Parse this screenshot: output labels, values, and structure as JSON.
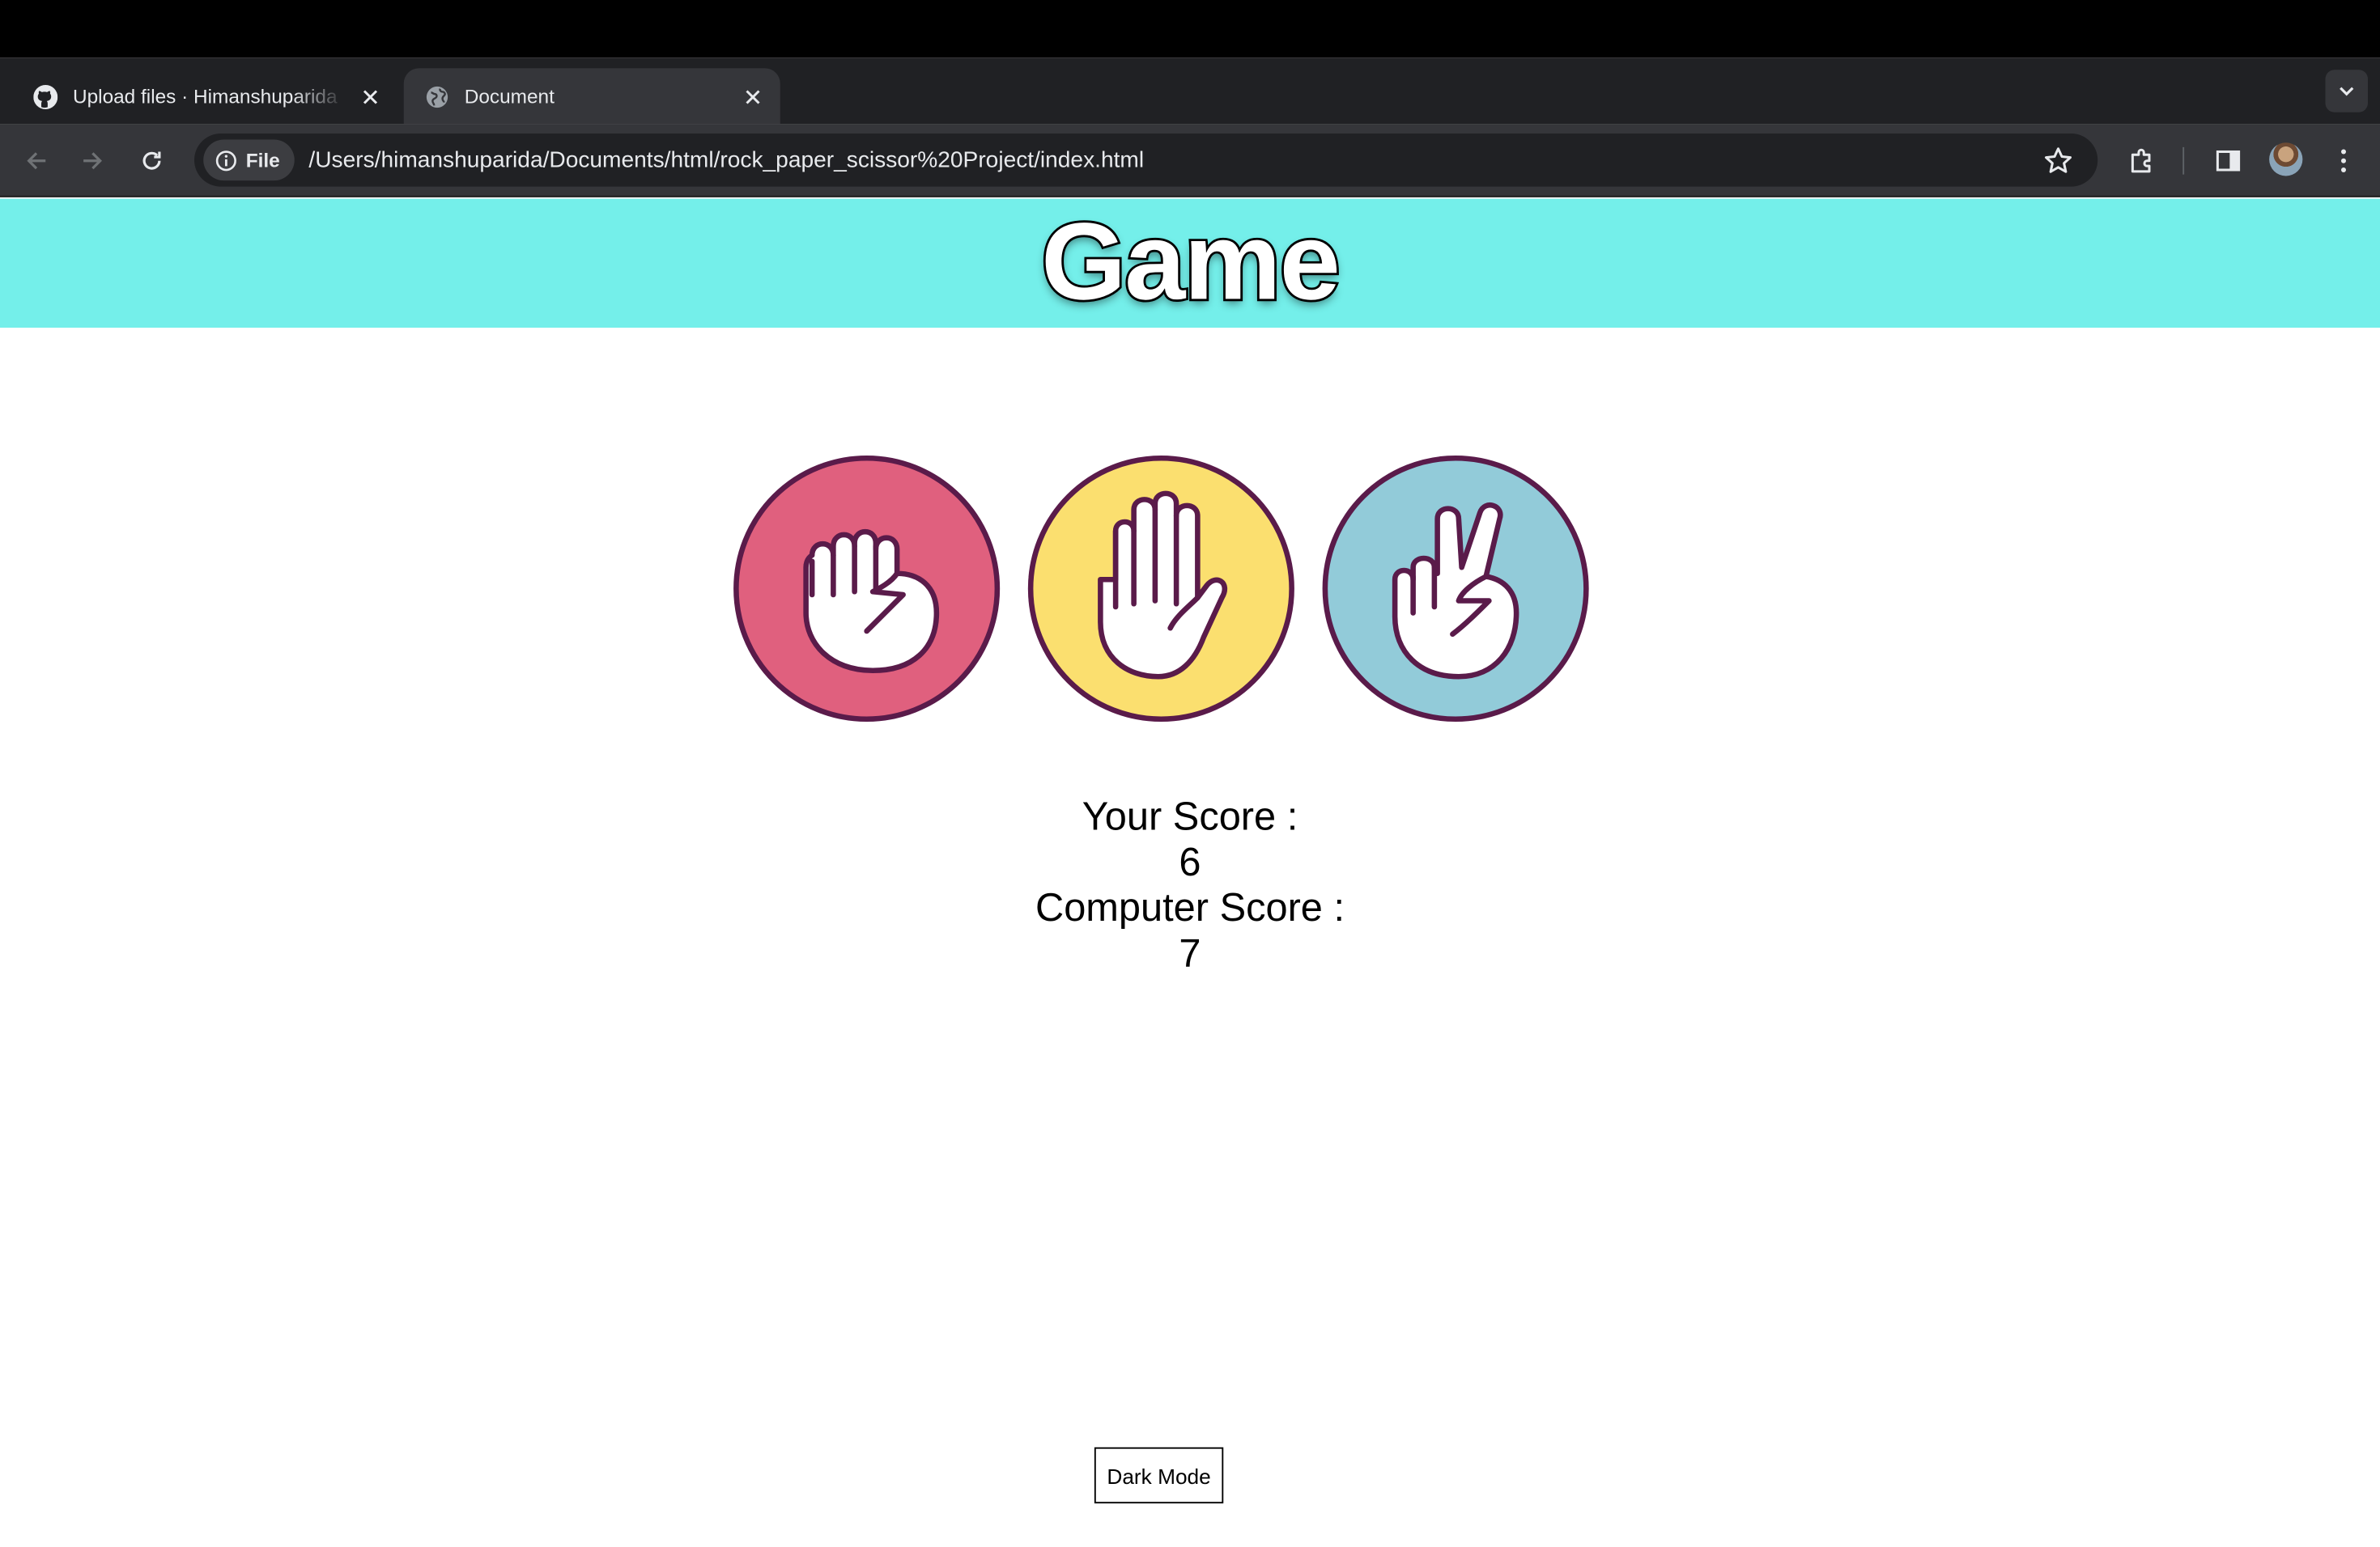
{
  "browser": {
    "tabs": [
      {
        "title": "Upload files · Himanshuparida",
        "favicon": "github-icon",
        "active": false
      },
      {
        "title": "Document",
        "favicon": "globe-icon",
        "active": true
      }
    ],
    "site_chip": "File",
    "url": "/Users/himanshuparida/Documents/html/rock_paper_scissor%20Project/index.html"
  },
  "page": {
    "title": "Game",
    "header_color": "#74efea",
    "choices": [
      {
        "id": "rock",
        "icon": "rock-hand-icon",
        "color": "#e0607e"
      },
      {
        "id": "paper",
        "icon": "paper-hand-icon",
        "color": "#fbdf6f"
      },
      {
        "id": "scissors",
        "icon": "scissors-hand-icon",
        "color": "#92cbd9"
      }
    ],
    "user_score_label": "Your Score :",
    "user_score": "6",
    "computer_score_label": "Computer Score :",
    "computer_score": "7",
    "dark_mode_label": "Dark Mode"
  }
}
